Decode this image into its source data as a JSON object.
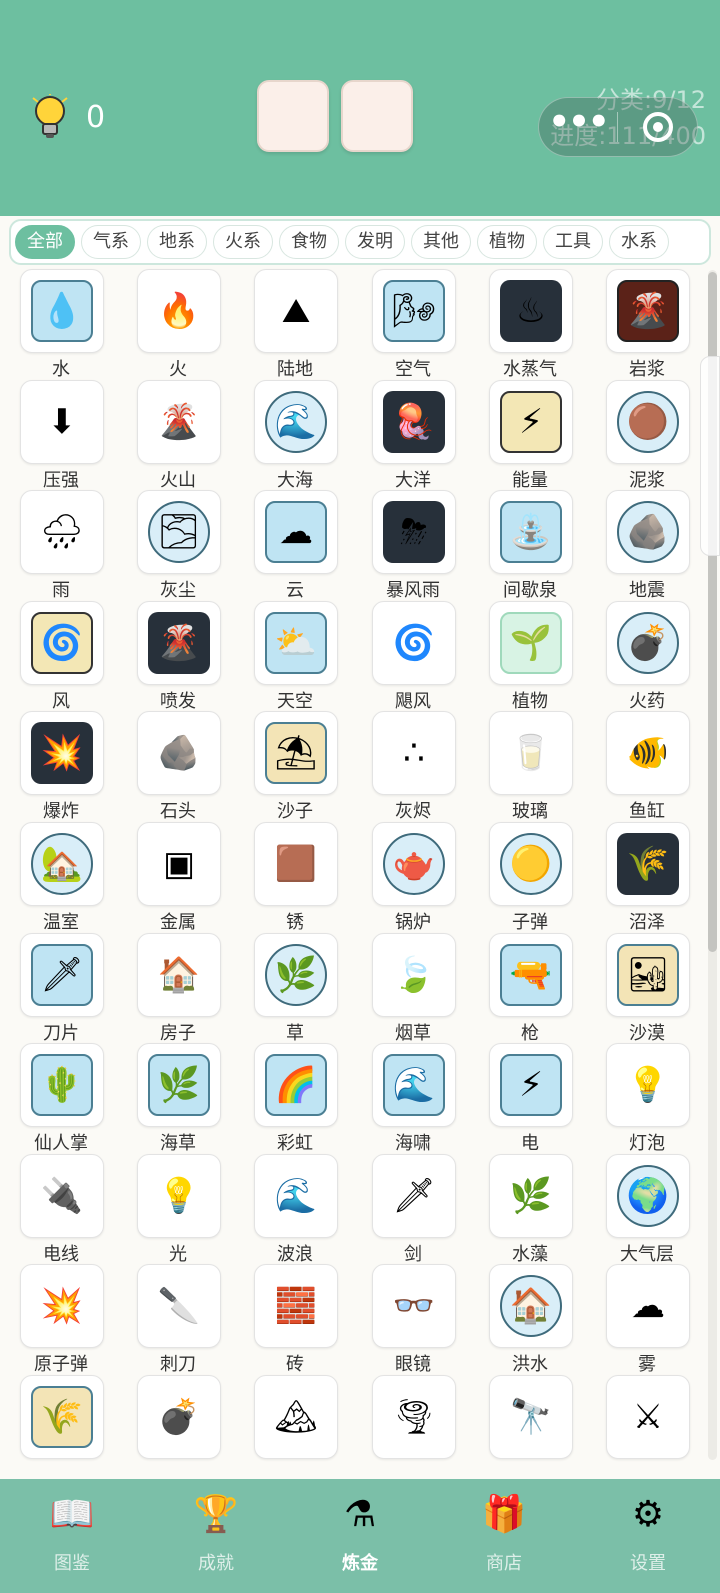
{
  "header": {
    "hint_count": "0",
    "category_progress": "分类:9/12",
    "progress": "进度:111/400"
  },
  "tabs": [
    {
      "label": "全部",
      "active": true
    },
    {
      "label": "气系"
    },
    {
      "label": "地系"
    },
    {
      "label": "火系"
    },
    {
      "label": "食物"
    },
    {
      "label": "发明"
    },
    {
      "label": "其他"
    },
    {
      "label": "植物"
    },
    {
      "label": "工具"
    },
    {
      "label": "水系"
    }
  ],
  "elements": [
    {
      "label": "水",
      "icon": "water-drop-icon",
      "glyph": "💧",
      "style": "sq"
    },
    {
      "label": "火",
      "icon": "fire-icon",
      "glyph": "🔥",
      "style": "plain"
    },
    {
      "label": "陆地",
      "icon": "land-icon",
      "glyph": "⛰",
      "style": "plain"
    },
    {
      "label": "空气",
      "icon": "air-icon",
      "glyph": "🌬",
      "style": "sq"
    },
    {
      "label": "水蒸气",
      "icon": "steam-icon",
      "glyph": "♨",
      "style": "dark"
    },
    {
      "label": "岩浆",
      "icon": "lava-icon",
      "glyph": "🌋",
      "style": "lava"
    },
    {
      "label": "压强",
      "icon": "pressure-arrow-icon",
      "glyph": "⬇",
      "style": "plain"
    },
    {
      "label": "火山",
      "icon": "volcano-icon",
      "glyph": "🌋",
      "style": "plain"
    },
    {
      "label": "大海",
      "icon": "sea-wave-icon",
      "glyph": "🌊",
      "style": "circ"
    },
    {
      "label": "大洋",
      "icon": "ocean-jellyfish-icon",
      "glyph": "🪼",
      "style": "dark"
    },
    {
      "label": "能量",
      "icon": "energy-icon",
      "glyph": "⚡",
      "style": "sun"
    },
    {
      "label": "泥浆",
      "icon": "mud-icon",
      "glyph": "🟤",
      "style": "circ"
    },
    {
      "label": "雨",
      "icon": "rain-icon",
      "glyph": "🌧",
      "style": "plain"
    },
    {
      "label": "灰尘",
      "icon": "dust-icon",
      "glyph": "🌫",
      "style": "circ"
    },
    {
      "label": "云",
      "icon": "cloud-icon",
      "glyph": "☁",
      "style": "sq"
    },
    {
      "label": "暴风雨",
      "icon": "storm-icon",
      "glyph": "⛈",
      "style": "dark"
    },
    {
      "label": "间歇泉",
      "icon": "geyser-icon",
      "glyph": "⛲",
      "style": "sq"
    },
    {
      "label": "地震",
      "icon": "earthquake-icon",
      "glyph": "🪨",
      "style": "circ"
    },
    {
      "label": "风",
      "icon": "wind-icon",
      "glyph": "🌀",
      "style": "sun"
    },
    {
      "label": "喷发",
      "icon": "eruption-icon",
      "glyph": "🌋",
      "style": "dark"
    },
    {
      "label": "天空",
      "icon": "sky-icon",
      "glyph": "⛅",
      "style": "sq"
    },
    {
      "label": "飓风",
      "icon": "hurricane-icon",
      "glyph": "🌀",
      "style": "plain"
    },
    {
      "label": "植物",
      "icon": "plant-icon",
      "glyph": "🌱",
      "style": "green"
    },
    {
      "label": "火药",
      "icon": "gunpowder-icon",
      "glyph": "💣",
      "style": "circ"
    },
    {
      "label": "爆炸",
      "icon": "explosion-icon",
      "glyph": "💥",
      "style": "dark"
    },
    {
      "label": "石头",
      "icon": "stone-icon",
      "glyph": "🪨",
      "style": "plain"
    },
    {
      "label": "沙子",
      "icon": "sand-icon",
      "glyph": "⛱",
      "style": "sand"
    },
    {
      "label": "灰烬",
      "icon": "ash-icon",
      "glyph": "∴",
      "style": "plain"
    },
    {
      "label": "玻璃",
      "icon": "glass-icon",
      "glyph": "🥛",
      "style": "plain"
    },
    {
      "label": "鱼缸",
      "icon": "fishbowl-icon",
      "glyph": "🐠",
      "style": "plain"
    },
    {
      "label": "温室",
      "icon": "greenhouse-icon",
      "glyph": "🏡",
      "style": "circ"
    },
    {
      "label": "金属",
      "icon": "metal-block-icon",
      "glyph": "▣",
      "style": "plain"
    },
    {
      "label": "锈",
      "icon": "rust-icon",
      "glyph": "🟫",
      "style": "plain"
    },
    {
      "label": "锅炉",
      "icon": "boiler-kettle-icon",
      "glyph": "🫖",
      "style": "circ"
    },
    {
      "label": "子弹",
      "icon": "bullet-icon",
      "glyph": "🟡",
      "style": "circ"
    },
    {
      "label": "沼泽",
      "icon": "swamp-icon",
      "glyph": "🌾",
      "style": "dark"
    },
    {
      "label": "刀片",
      "icon": "blade-icon",
      "glyph": "🗡",
      "style": "sq"
    },
    {
      "label": "房子",
      "icon": "house-icon",
      "glyph": "🏠",
      "style": "plain"
    },
    {
      "label": "草",
      "icon": "grass-icon",
      "glyph": "🌿",
      "style": "circ"
    },
    {
      "label": "烟草",
      "icon": "tobacco-leaf-icon",
      "glyph": "🍃",
      "style": "plain"
    },
    {
      "label": "枪",
      "icon": "gun-icon",
      "glyph": "🔫",
      "style": "sq"
    },
    {
      "label": "沙漠",
      "icon": "desert-icon",
      "glyph": "🏜",
      "style": "sand"
    },
    {
      "label": "仙人掌",
      "icon": "cactus-icon",
      "glyph": "🌵",
      "style": "sq"
    },
    {
      "label": "海草",
      "icon": "seaweed-icon",
      "glyph": "🌿",
      "style": "sq"
    },
    {
      "label": "彩虹",
      "icon": "rainbow-icon",
      "glyph": "🌈",
      "style": "sq"
    },
    {
      "label": "海啸",
      "icon": "tsunami-icon",
      "glyph": "🌊",
      "style": "sq"
    },
    {
      "label": "电",
      "icon": "electricity-icon",
      "glyph": "⚡",
      "style": "sq"
    },
    {
      "label": "灯泡",
      "icon": "light-bulb-icon",
      "glyph": "💡",
      "style": "plain"
    },
    {
      "label": "电线",
      "icon": "wire-icon",
      "glyph": "🔌",
      "style": "plain"
    },
    {
      "label": "光",
      "icon": "light-icon",
      "glyph": "💡",
      "style": "plain"
    },
    {
      "label": "波浪",
      "icon": "waves-icon",
      "glyph": "🌊",
      "style": "plain"
    },
    {
      "label": "剑",
      "icon": "sword-icon",
      "glyph": "🗡",
      "style": "plain"
    },
    {
      "label": "水藻",
      "icon": "algae-icon",
      "glyph": "🌿",
      "style": "plain"
    },
    {
      "label": "大气层",
      "icon": "atmosphere-icon",
      "glyph": "🌍",
      "style": "circ"
    },
    {
      "label": "原子弹",
      "icon": "atomic-bomb-icon",
      "glyph": "💥",
      "style": "plain"
    },
    {
      "label": "刺刀",
      "icon": "bayonet-icon",
      "glyph": "🔪",
      "style": "plain"
    },
    {
      "label": "砖",
      "icon": "brick-icon",
      "glyph": "🧱",
      "style": "plain"
    },
    {
      "label": "眼镜",
      "icon": "glasses-icon",
      "glyph": "👓",
      "style": "plain"
    },
    {
      "label": "洪水",
      "icon": "flood-icon",
      "glyph": "🏠",
      "style": "circ"
    },
    {
      "label": "雾",
      "icon": "fog-icon",
      "glyph": "☁",
      "style": "plain"
    },
    {
      "label": "",
      "icon": "farm-field-icon",
      "glyph": "🌾",
      "style": "sand"
    },
    {
      "label": "",
      "icon": "grenade-icon",
      "glyph": "💣",
      "style": "plain"
    },
    {
      "label": "",
      "icon": "mountains-icon",
      "glyph": "🏔",
      "style": "plain"
    },
    {
      "label": "",
      "icon": "tornado-icon",
      "glyph": "🌪",
      "style": "plain"
    },
    {
      "label": "",
      "icon": "telescope-icon",
      "glyph": "🔭",
      "style": "plain"
    },
    {
      "label": "",
      "icon": "lightsaber-icon",
      "glyph": "⚔",
      "style": "plain"
    }
  ],
  "bottom_nav": [
    {
      "label": "图鉴",
      "icon": "book-icon",
      "glyph": "📖"
    },
    {
      "label": "成就",
      "icon": "trophy-icon",
      "glyph": "🏆"
    },
    {
      "label": "炼金",
      "icon": "potion-flask-icon",
      "glyph": "⚗",
      "active": true
    },
    {
      "label": "商店",
      "icon": "gift-box-icon",
      "glyph": "🎁"
    },
    {
      "label": "设置",
      "icon": "gear-icon",
      "glyph": "⚙"
    }
  ],
  "colors": {
    "header": "#6dbfa0",
    "nav": "#7bbfa8",
    "active_tab": "#6dbfa0",
    "slot": "#fbefe9"
  }
}
